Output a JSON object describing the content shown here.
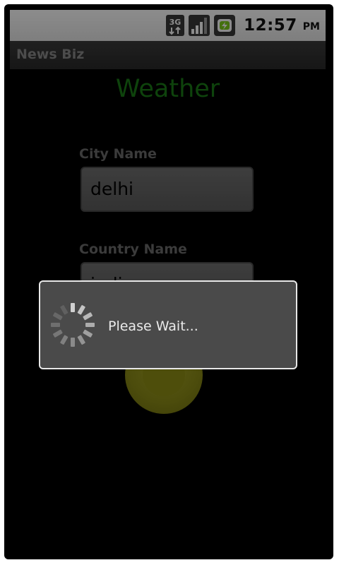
{
  "status_bar": {
    "network_label": "3G",
    "time": "12:57",
    "ampm": "PM",
    "icons": [
      "3g-data-icon",
      "signal-strength-icon",
      "battery-charging-icon"
    ]
  },
  "app": {
    "title": "News Biz"
  },
  "main": {
    "heading": "Weather",
    "city_label": "City Name",
    "city_value": "delhi",
    "country_label": "Country Name",
    "country_value": "india"
  },
  "dialog": {
    "message": "Please Wait..."
  },
  "colors": {
    "heading": "#1a7a16",
    "status_bar": "#f2f2f2",
    "title_bar": "#333333",
    "dialog_bg": "#4a4a4a",
    "submit_button": "#9a9a1e"
  }
}
